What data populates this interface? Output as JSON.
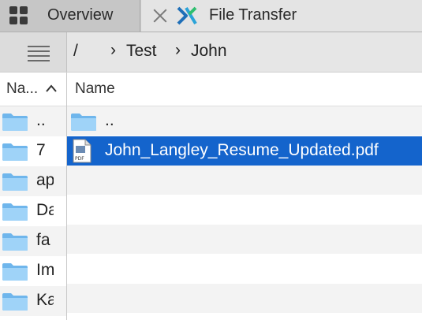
{
  "tabs": {
    "overview_label": "Overview",
    "file_transfer_label": "File Transfer"
  },
  "breadcrumb": {
    "root": "/",
    "items": [
      "Test",
      "John"
    ]
  },
  "left_pane": {
    "column_header": "Na...",
    "sort_indicator": "^",
    "items": [
      "..",
      "7",
      "ap",
      "Da",
      "fa",
      "Im",
      "Ka"
    ]
  },
  "main_pane": {
    "column_header": "Name",
    "items": [
      {
        "name": "..",
        "type": "folder-icon"
      },
      {
        "name": "John_Langley_Resume_Updated.pdf",
        "type": "pdf-icon",
        "selected": true
      }
    ]
  },
  "icons": {
    "pdf_badge": "PDF"
  },
  "colors": {
    "selection": "#1464cc",
    "folder": "#8cc8f5",
    "alt_row": "#f3f3f3"
  }
}
